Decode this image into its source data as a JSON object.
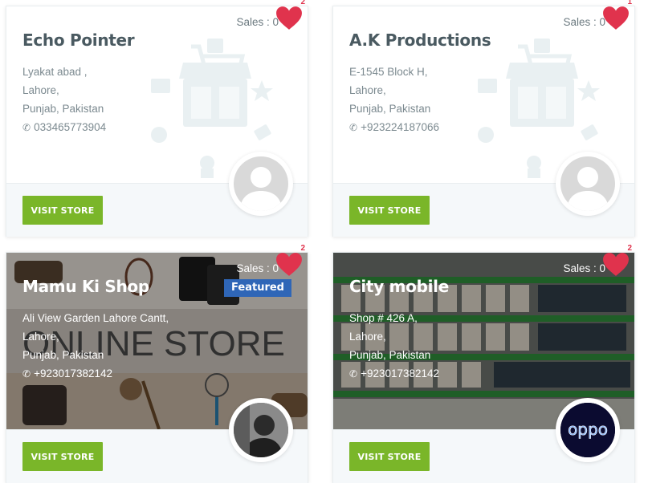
{
  "stores": [
    {
      "name": "Echo Pointer",
      "address": [
        "Lyakat abad ,",
        "Lahore,",
        "Punjab, Pakistan"
      ],
      "phone": "033465773904",
      "sales": "Sales : 0",
      "favorites": "2",
      "featured": "",
      "button": "VISIT STORE",
      "banner": "default-illustration",
      "avatar": "default-avatar-icon"
    },
    {
      "name": "A.K Productions",
      "address": [
        "E-1545 Block H,",
        "Lahore,",
        "Punjab, Pakistan"
      ],
      "phone": "+923224187066",
      "sales": "Sales : 0",
      "favorites": "1",
      "featured": "",
      "button": "VISIT STORE",
      "banner": "default-illustration",
      "avatar": "default-avatar-icon"
    },
    {
      "name": "Mamu Ki Shop",
      "address": [
        "Ali View Garden Lahore Cantt,",
        "Lahore,",
        "Punjab, Pakistan"
      ],
      "phone": "+923017382142",
      "sales": "Sales : 0",
      "favorites": "2",
      "featured": "Featured",
      "button": "VISIT STORE",
      "banner": "online-store-photo",
      "banner_text": "ONLINE STORE",
      "avatar": "person-photo"
    },
    {
      "name": "City mobile",
      "address": [
        "Shop # 426 A,",
        "Lahore,",
        "Punjab, Pakistan"
      ],
      "phone": "+923017382142",
      "sales": "Sales : 0",
      "favorites": "2",
      "featured": "",
      "button": "VISIT STORE",
      "banner": "mobile-shop-photo",
      "banner_text": "oppo",
      "avatar": "oppo-logo"
    }
  ],
  "colors": {
    "accent_green": "#7ab629",
    "heart_red": "#e0334d",
    "featured_blue": "#2f66b7"
  }
}
